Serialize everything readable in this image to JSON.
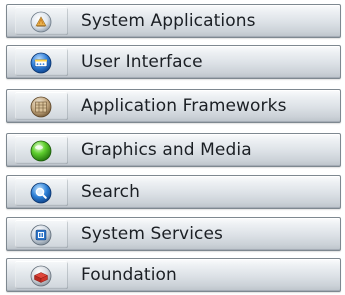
{
  "layers": [
    {
      "label": "System Applications",
      "icon": "system-applications-icon"
    },
    {
      "label": "User Interface",
      "icon": "user-interface-icon"
    },
    {
      "label": "Application Frameworks",
      "icon": "application-frameworks-icon"
    },
    {
      "label": "Graphics and Media",
      "icon": "graphics-and-media-icon"
    },
    {
      "label": "Search",
      "icon": "search-icon"
    },
    {
      "label": "System Services",
      "icon": "system-services-icon"
    },
    {
      "label": "Foundation",
      "icon": "foundation-icon"
    }
  ]
}
